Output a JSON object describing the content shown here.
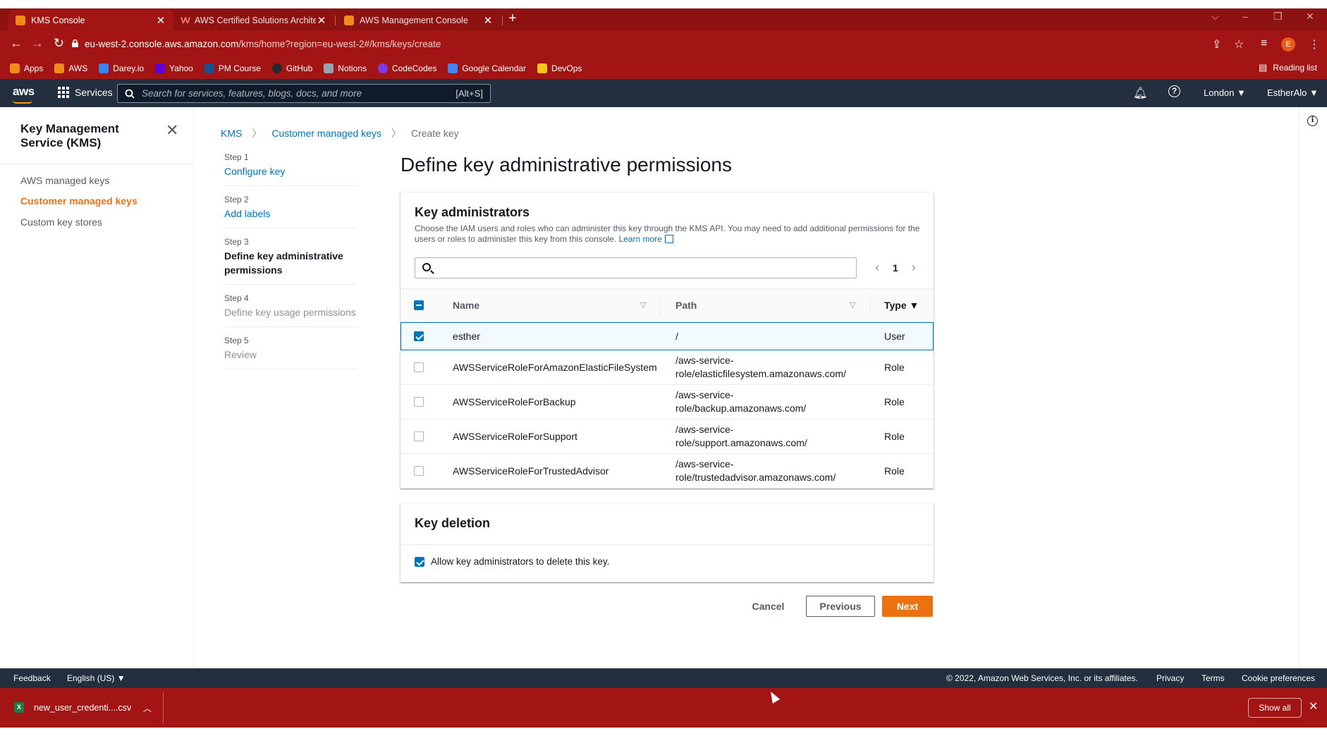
{
  "browser": {
    "tabs": [
      {
        "label": "KMS Console",
        "active": true
      },
      {
        "label": "AWS Certified Solutions Architect",
        "active": false
      },
      {
        "label": "AWS Management Console",
        "active": false
      }
    ],
    "url_host": "eu-west-2.console.aws.amazon.com",
    "url_rest": "/kms/home?region=eu-west-2#/kms/keys/create",
    "profile_initial": "E",
    "bookmarks": [
      {
        "label": "Apps",
        "color": "#f28b1b"
      },
      {
        "label": "AWS",
        "color": "#f08b1d"
      },
      {
        "label": "Darey.io",
        "color": "#3b82f6"
      },
      {
        "label": "Yahoo",
        "color": "#6001d2"
      },
      {
        "label": "PM Course",
        "color": "#1f4f8f"
      },
      {
        "label": "GitHub",
        "color": "#24292e"
      },
      {
        "label": "Notions",
        "color": "#9aa4b1"
      },
      {
        "label": "CodeCodes",
        "color": "#7c3aed"
      },
      {
        "label": "Google Calendar",
        "color": "#4285f4"
      },
      {
        "label": "DevOps",
        "color": "#f5c518"
      }
    ],
    "reading_list": "Reading list"
  },
  "aws_header": {
    "logo": "aws",
    "services": "Services",
    "search_placeholder": "Search for services, features, blogs, docs, and more",
    "search_shortcut": "[Alt+S]",
    "region": "London ▼",
    "user": "EstherAlo ▼"
  },
  "sidebar": {
    "title": "Key Management Service (KMS)",
    "items": [
      {
        "label": "AWS managed keys",
        "active": false
      },
      {
        "label": "Customer managed keys",
        "active": true
      },
      {
        "label": "Custom key stores",
        "active": false
      }
    ]
  },
  "breadcrumb": {
    "items": [
      "KMS",
      "Customer managed keys"
    ],
    "current": "Create key"
  },
  "steps": [
    {
      "num": "Step 1",
      "label": "Configure key",
      "state": "link"
    },
    {
      "num": "Step 2",
      "label": "Add labels",
      "state": "link"
    },
    {
      "num": "Step 3",
      "label": "Define key administrative permissions",
      "state": "current"
    },
    {
      "num": "Step 4",
      "label": "Define key usage permissions",
      "state": "disabled"
    },
    {
      "num": "Step 5",
      "label": "Review",
      "state": "disabled"
    }
  ],
  "page_title": "Define key administrative permissions",
  "key_admins": {
    "title": "Key administrators",
    "description": "Choose the IAM users and roles who can administer this key through the KMS API. You may need to add additional permissions for the users or roles to administer this key from this console.",
    "learn_more": "Learn more",
    "page": "1",
    "columns": {
      "name": "Name",
      "path": "Path",
      "type": "Type ▼"
    },
    "rows": [
      {
        "name": "esther",
        "path": "/",
        "type": "User",
        "checked": true
      },
      {
        "name": "AWSServiceRoleForAmazonElasticFileSystem",
        "path": "/aws-service-role/elasticfilesystem.amazonaws.com/",
        "type": "Role",
        "checked": false
      },
      {
        "name": "AWSServiceRoleForBackup",
        "path": "/aws-service-role/backup.amazonaws.com/",
        "type": "Role",
        "checked": false
      },
      {
        "name": "AWSServiceRoleForSupport",
        "path": "/aws-service-role/support.amazonaws.com/",
        "type": "Role",
        "checked": false
      },
      {
        "name": "AWSServiceRoleForTrustedAdvisor",
        "path": "/aws-service-role/trustedadvisor.amazonaws.com/",
        "type": "Role",
        "checked": false
      }
    ]
  },
  "key_deletion": {
    "title": "Key deletion",
    "checkbox_label": "Allow key administrators to delete this key.",
    "checked": true
  },
  "actions": {
    "cancel": "Cancel",
    "previous": "Previous",
    "next": "Next"
  },
  "footer": {
    "feedback": "Feedback",
    "language": "English (US) ▼",
    "copyright": "© 2022, Amazon Web Services, Inc. or its affiliates.",
    "privacy": "Privacy",
    "terms": "Terms",
    "cookies": "Cookie preferences"
  },
  "download": {
    "filename": "new_user_credenti....csv",
    "show_all": "Show all"
  }
}
